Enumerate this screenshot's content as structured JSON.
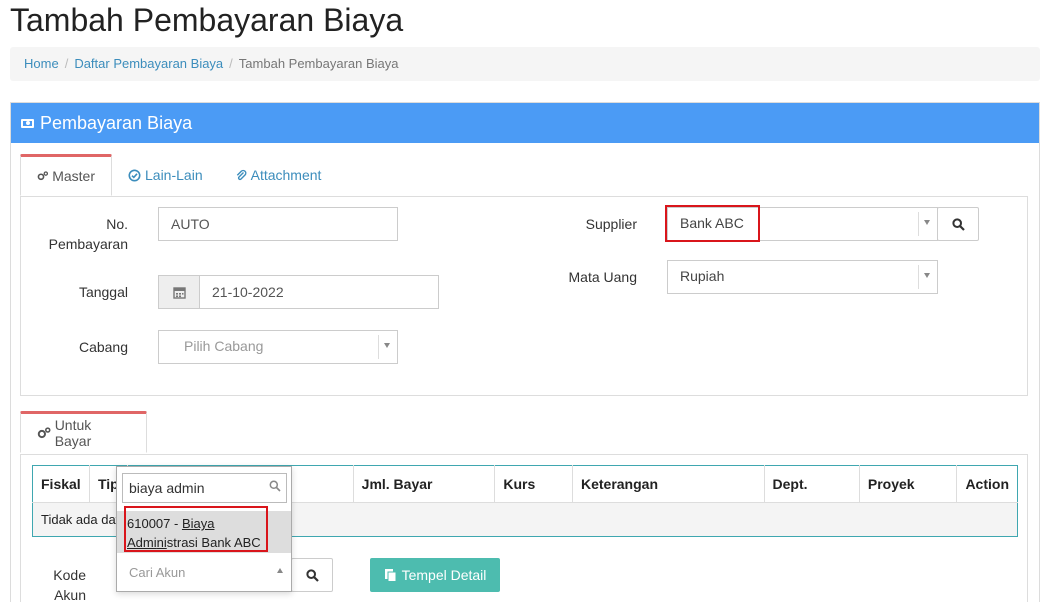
{
  "page": {
    "title": "Tambah Pembayaran Biaya"
  },
  "breadcrumb": {
    "home": "Home",
    "list": "Daftar Pembayaran Biaya",
    "current": "Tambah Pembayaran Biaya"
  },
  "panel": {
    "title": "Pembayaran Biaya"
  },
  "tabs": [
    {
      "label": "Master",
      "icon": "gears-icon",
      "active": true
    },
    {
      "label": "Lain-Lain",
      "icon": "check-circle-icon",
      "active": false
    },
    {
      "label": "Attachment",
      "icon": "paperclip-icon",
      "active": false
    }
  ],
  "form": {
    "no_pembayaran_label_1": "No.",
    "no_pembayaran_label_2": "Pembayaran",
    "no_pembayaran_value": "AUTO",
    "tanggal_label": "Tanggal",
    "tanggal_value": "21-10-2022",
    "cabang_label": "Cabang",
    "cabang_placeholder": "Pilih Cabang",
    "supplier_label": "Supplier",
    "supplier_value": "Bank ABC",
    "mata_uang_label": "Mata Uang",
    "mata_uang_value": "Rupiah"
  },
  "detail": {
    "tab_label": "Untuk Bayar",
    "columns": [
      "Fiskal",
      "Tip",
      "",
      "Jml. Bayar",
      "Kurs",
      "Keterangan",
      "Dept.",
      "Proyek",
      "Action"
    ],
    "empty_text": "Tidak ada dat",
    "kode_akun_label_1": "Kode",
    "kode_akun_label_2": "Akun",
    "paste_button": "Tempel Detail"
  },
  "account_dropdown": {
    "search_value": "biaya admin",
    "result_code": "610007 - ",
    "result_match_1": "Biaya",
    "result_match_2": "Admi",
    "result_match_3": "ni",
    "result_rest": "strasi Bank ABC",
    "placeholder": "Cari Akun"
  },
  "colors": {
    "panel_header": "#4b9bf5",
    "link": "#3c8dbc",
    "highlight": "#d9151b",
    "teal_button": "#4dbcaf",
    "tab_active_border": "#e06666"
  }
}
